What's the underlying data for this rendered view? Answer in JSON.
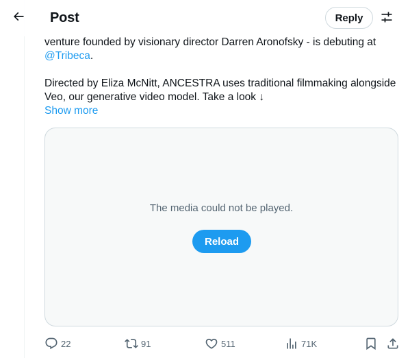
{
  "header": {
    "title": "Post",
    "reply_label": "Reply",
    "back_icon": "arrow-left-icon",
    "filter_icon": "sliders-icon"
  },
  "tweet": {
    "line1": "venture founded by visionary director Darren Aronofsky - is debuting at",
    "mention": "@Tribeca",
    "mention_suffix": ".",
    "para2": "Directed by Eliza McNitt, ANCESTRA uses traditional filmmaking alongside Veo, our generative video model. Take a look ↓",
    "show_more": "Show more"
  },
  "media": {
    "message": "The media could not be played.",
    "reload_label": "Reload"
  },
  "actions": {
    "replies": "22",
    "reposts": "91",
    "likes": "511",
    "views": "71K"
  },
  "colors": {
    "accent": "#1d9bf0",
    "text": "#0f1419",
    "secondary": "#536471",
    "border": "#cfd9de"
  }
}
